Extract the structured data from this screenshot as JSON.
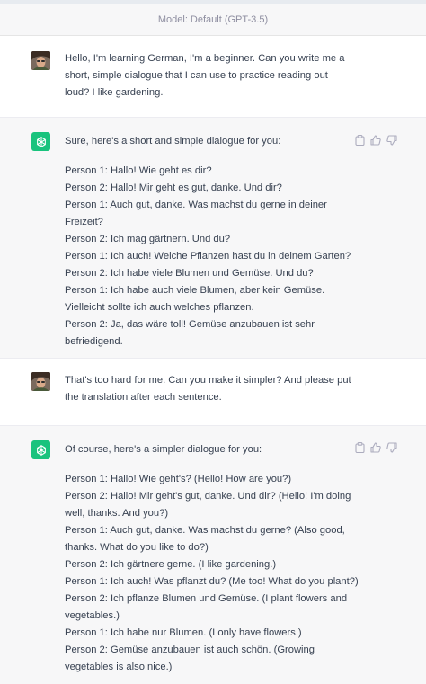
{
  "header": {
    "model_label": "Model: Default (GPT-3.5)"
  },
  "messages": [
    {
      "role": "user",
      "lines": [
        "Hello, I'm learning German, I'm a beginner. Can you write me a",
        "short, simple dialogue that I can use to practice reading out",
        "loud? I like gardening."
      ]
    },
    {
      "role": "assistant",
      "intro": "Sure, here's a short and simple dialogue for you:",
      "lines": [
        "Person 1: Hallo! Wie geht es dir?",
        "Person 2: Hallo! Mir geht es gut, danke. Und dir?",
        "Person 1: Auch gut, danke. Was machst du gerne in deiner",
        "Freizeit?",
        "Person 2: Ich mag gärtnern. Und du?",
        "Person 1: Ich auch! Welche Pflanzen hast du in deinem Garten?",
        "Person 2: Ich habe viele Blumen und Gemüse. Und du?",
        "Person 1: Ich habe auch viele Blumen, aber kein Gemüse.",
        "Vielleicht sollte ich auch welches pflanzen.",
        "Person 2: Ja, das wäre toll! Gemüse anzubauen ist sehr",
        "befriedigend."
      ]
    },
    {
      "role": "user",
      "lines": [
        "That's too hard for me. Can you make it simpler? And please put",
        "the translation after each sentence."
      ]
    },
    {
      "role": "assistant",
      "intro": "Of course, here's a simpler dialogue for you:",
      "lines": [
        "Person 1: Hallo! Wie geht's? (Hello! How are you?)",
        "Person 2: Hallo! Mir geht's gut, danke. Und dir? (Hello! I'm doing",
        "well, thanks. And you?)",
        "Person 1: Auch gut, danke. Was machst du gerne? (Also good,",
        "thanks. What do you like to do?)",
        "Person 2: Ich gärtnere gerne. (I like gardening.)",
        "Person 1: Ich auch! Was pflanzt du? (Me too! What do you plant?)",
        "Person 2: Ich pflanze Blumen und Gemüse. (I plant flowers and",
        "vegetables.)",
        "Person 1: Ich habe nur Blumen. (I only have flowers.)",
        "Person 2: Gemüse anzubauen ist auch schön. (Growing",
        "vegetables is also nice.)"
      ]
    }
  ],
  "icons": {
    "copy": "clipboard-icon",
    "like": "thumbs-up-icon",
    "dislike": "thumbs-down-icon",
    "bot": "openai-logo-icon",
    "user": "user-avatar"
  },
  "colors": {
    "bot_avatar_bg": "#19c37d",
    "assistant_bg": "#f7f7f8",
    "text": "#374151"
  }
}
